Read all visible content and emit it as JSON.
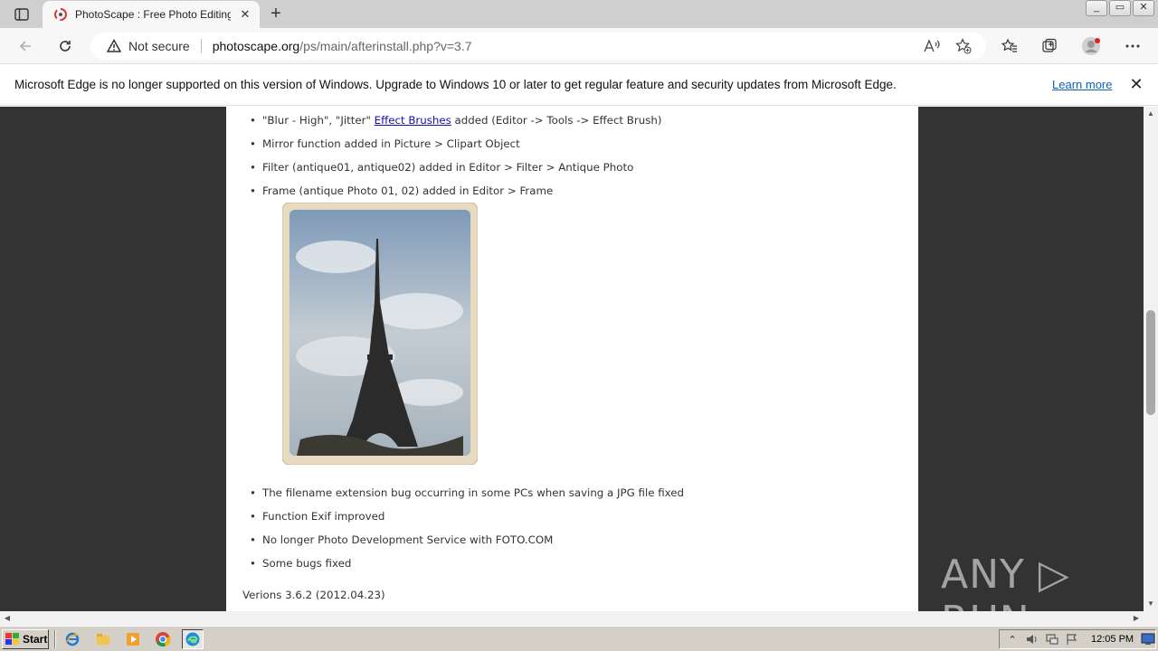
{
  "browser": {
    "tab": {
      "title": "PhotoScape : Free Photo Editing",
      "close": "✕"
    },
    "new_tab": "+",
    "window_controls": [
      "_",
      "▭",
      "✕"
    ],
    "address": {
      "security_label": "Not secure",
      "url_host": "photoscape.org",
      "url_path": "/ps/main/afterinstall.php?v=3.7"
    }
  },
  "infobar": {
    "message": "Microsoft Edge is no longer supported on this version of Windows. Upgrade to Windows 10 or later to get regular feature and security updates from Microsoft Edge.",
    "link": "Learn more",
    "close": "✕"
  },
  "page": {
    "bullets_top": [
      {
        "pre": "\"Blur - High\", \"Jitter\" ",
        "link": "Effect Brushes",
        "post": " added (Editor -> Tools -> Effect Brush)"
      },
      {
        "pre": "Mirror function added in Picture > Clipart Object",
        "link": "",
        "post": ""
      },
      {
        "pre": "Filter (antique01, antique02) added in Editor > Filter > Antique Photo",
        "link": "",
        "post": ""
      },
      {
        "pre": "Frame (antique Photo 01, 02) added in Editor > Frame",
        "link": "",
        "post": ""
      }
    ],
    "bullets_bottom": [
      "The filename extension bug occurring in some PCs when saving a JPG file fixed",
      "Function Exif improved",
      "No longer Photo Development Service with FOTO.COM",
      "Some bugs fixed"
    ],
    "version_heading": "Verions 3.6.2 (2012.04.23)"
  },
  "watermark": "ANY ▷ RUN",
  "taskbar": {
    "start_label": "Start",
    "clock": "12:05 PM"
  },
  "colors": {
    "page_bg": "#333333",
    "content_bg": "#ffffff",
    "link": "#1a0dab",
    "infobar_link": "#0b63b8"
  }
}
